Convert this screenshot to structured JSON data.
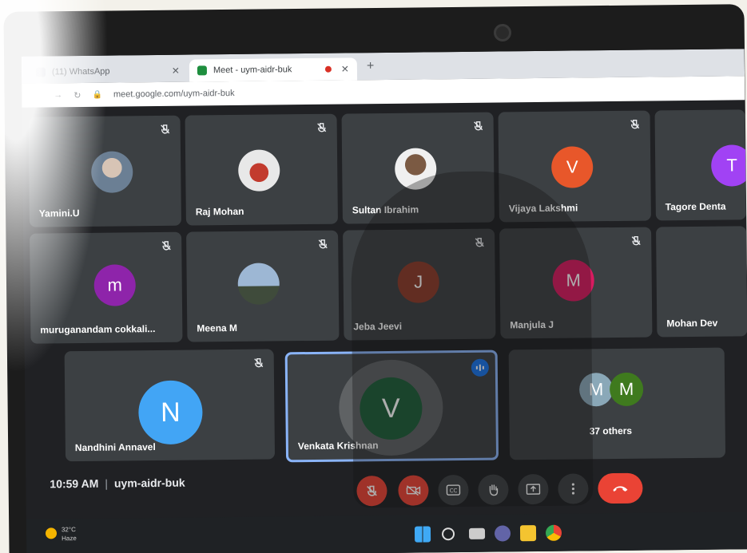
{
  "browser": {
    "tabs": [
      {
        "label": "(11) WhatsApp",
        "active": false
      },
      {
        "label": "Meet - uym-aidr-buk",
        "active": true
      }
    ],
    "url": "meet.google.com/uym-aidr-buk"
  },
  "participants": [
    {
      "name": "Yamini.U",
      "avatar": "photo"
    },
    {
      "name": "Raj Mohan",
      "avatar": "photo"
    },
    {
      "name": "Sultan Ibrahim",
      "avatar": "photo"
    },
    {
      "name": "Vijaya Lakshmi",
      "initial": "V",
      "color": "#e8572a"
    },
    {
      "name": "Tagore Denta",
      "initial": "T",
      "color": "#a142f4"
    },
    {
      "name": "muruganandam cokkali...",
      "initial": "m",
      "color": "#8e24aa"
    },
    {
      "name": "Meena M",
      "avatar": "photo"
    },
    {
      "name": "Jeba Jeevi",
      "initial": "J",
      "color": "#8d3b2a"
    },
    {
      "name": "Manjula J",
      "initial": "M",
      "color": "#d81b60"
    },
    {
      "name": "Mohan Dev"
    },
    {
      "name": "Nandhini Annavel",
      "initial": "N",
      "color": "#42a5f5"
    },
    {
      "name": "Venkata Krishnan",
      "initial": "V",
      "color": "#1e5e3a",
      "speaking": true
    }
  ],
  "others": {
    "label": "37 others",
    "initials": [
      "M",
      "M"
    ],
    "colors": [
      "#8aa8b8",
      "#3f7a1e"
    ]
  },
  "meeting": {
    "time": "10:59 AM",
    "code": "uym-aidr-buk"
  },
  "controls": [
    {
      "name": "mic-off",
      "color": "#ea4335"
    },
    {
      "name": "camera-off",
      "color": "#ea4335"
    },
    {
      "name": "captions"
    },
    {
      "name": "raise-hand"
    },
    {
      "name": "present"
    },
    {
      "name": "more-options"
    },
    {
      "name": "leave-call",
      "color": "#ea4335"
    }
  ],
  "taskbar": {
    "weather_temp": "32°C",
    "weather_desc": "Haze"
  }
}
